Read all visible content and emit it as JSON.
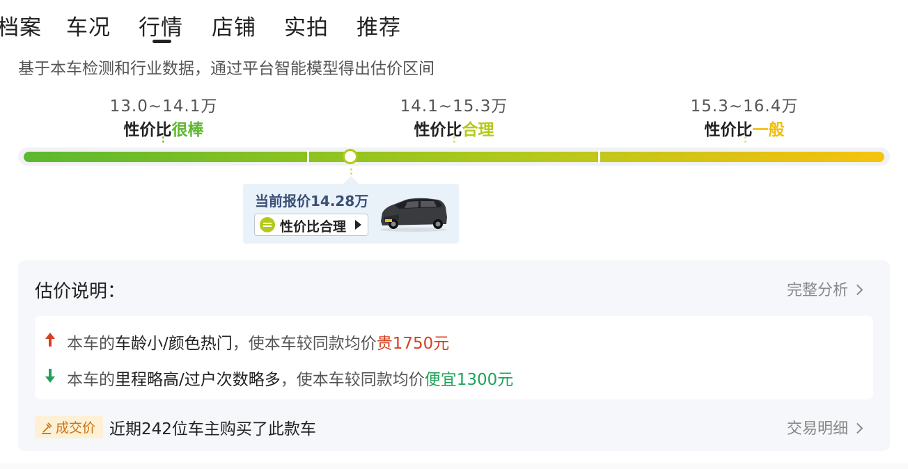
{
  "tabs": [
    {
      "label": "档案"
    },
    {
      "label": "车况"
    },
    {
      "label": "行情"
    },
    {
      "label": "店铺"
    },
    {
      "label": "实拍"
    },
    {
      "label": "推荐"
    }
  ],
  "active_tab": "行情",
  "subtitle": "基于本车检测和行业数据，通过平台智能模型得出估价区间",
  "ranges": [
    {
      "price": "13.0~14.1万",
      "prefix": "性价比",
      "level": "很棒",
      "color": "#5cb82e"
    },
    {
      "price": "14.1~15.3万",
      "prefix": "性价比",
      "level": "合理",
      "color": "#b5c91a"
    },
    {
      "price": "15.3~16.4万",
      "prefix": "性价比",
      "level": "一般",
      "color": "#f0be0f"
    }
  ],
  "current": {
    "title": "当前报价14.28万",
    "badge": "性价比合理"
  },
  "explain": {
    "title": "估价说明：",
    "link": "完整分析",
    "reasons": [
      {
        "pre": "本车的",
        "em": "车龄小/颜色热门",
        "mid": "，使本车较同款均价",
        "result": "贵1750元",
        "dir": "up"
      },
      {
        "pre": "本车的",
        "em": "里程略高/过户次数略多",
        "mid": "，使本车较同款均价",
        "result": "便宜1300元",
        "dir": "down"
      }
    ],
    "deal_badge": "成交价",
    "deal_text": "近期242位车主购买了此款车",
    "deal_link": "交易明细"
  },
  "colors": {
    "up": "#d6401f",
    "down": "#1fa35a",
    "card_bg": "#e9f1f9",
    "panel_bg": "#f5f7fa"
  }
}
